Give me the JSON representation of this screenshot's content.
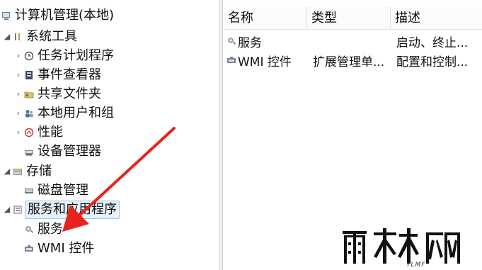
{
  "tree": {
    "root_label": "计算机管理(本地)",
    "system_tools": "系统工具",
    "task_scheduler": "任务计划程序",
    "event_viewer": "事件查看器",
    "shared_folders": "共享文件夹",
    "local_users": "本地用户和组",
    "performance": "性能",
    "device_manager": "设备管理器",
    "storage": "存储",
    "disk_management": "磁盘管理",
    "services_apps": "服务和应用程序",
    "services": "服务",
    "wmi": "WMI 控件"
  },
  "list": {
    "columns": [
      "名称",
      "类型",
      "描述"
    ],
    "rows": [
      {
        "name": "服务",
        "type": "",
        "desc": "启动、终止..."
      },
      {
        "name": "WMI 控件",
        "type": "扩展管理单...",
        "desc": "配置和控制..."
      }
    ]
  },
  "annotation": {
    "arrow_color": "#e8231d"
  },
  "watermark": {
    "text": "雨林木风",
    "sub": "YLMF"
  }
}
